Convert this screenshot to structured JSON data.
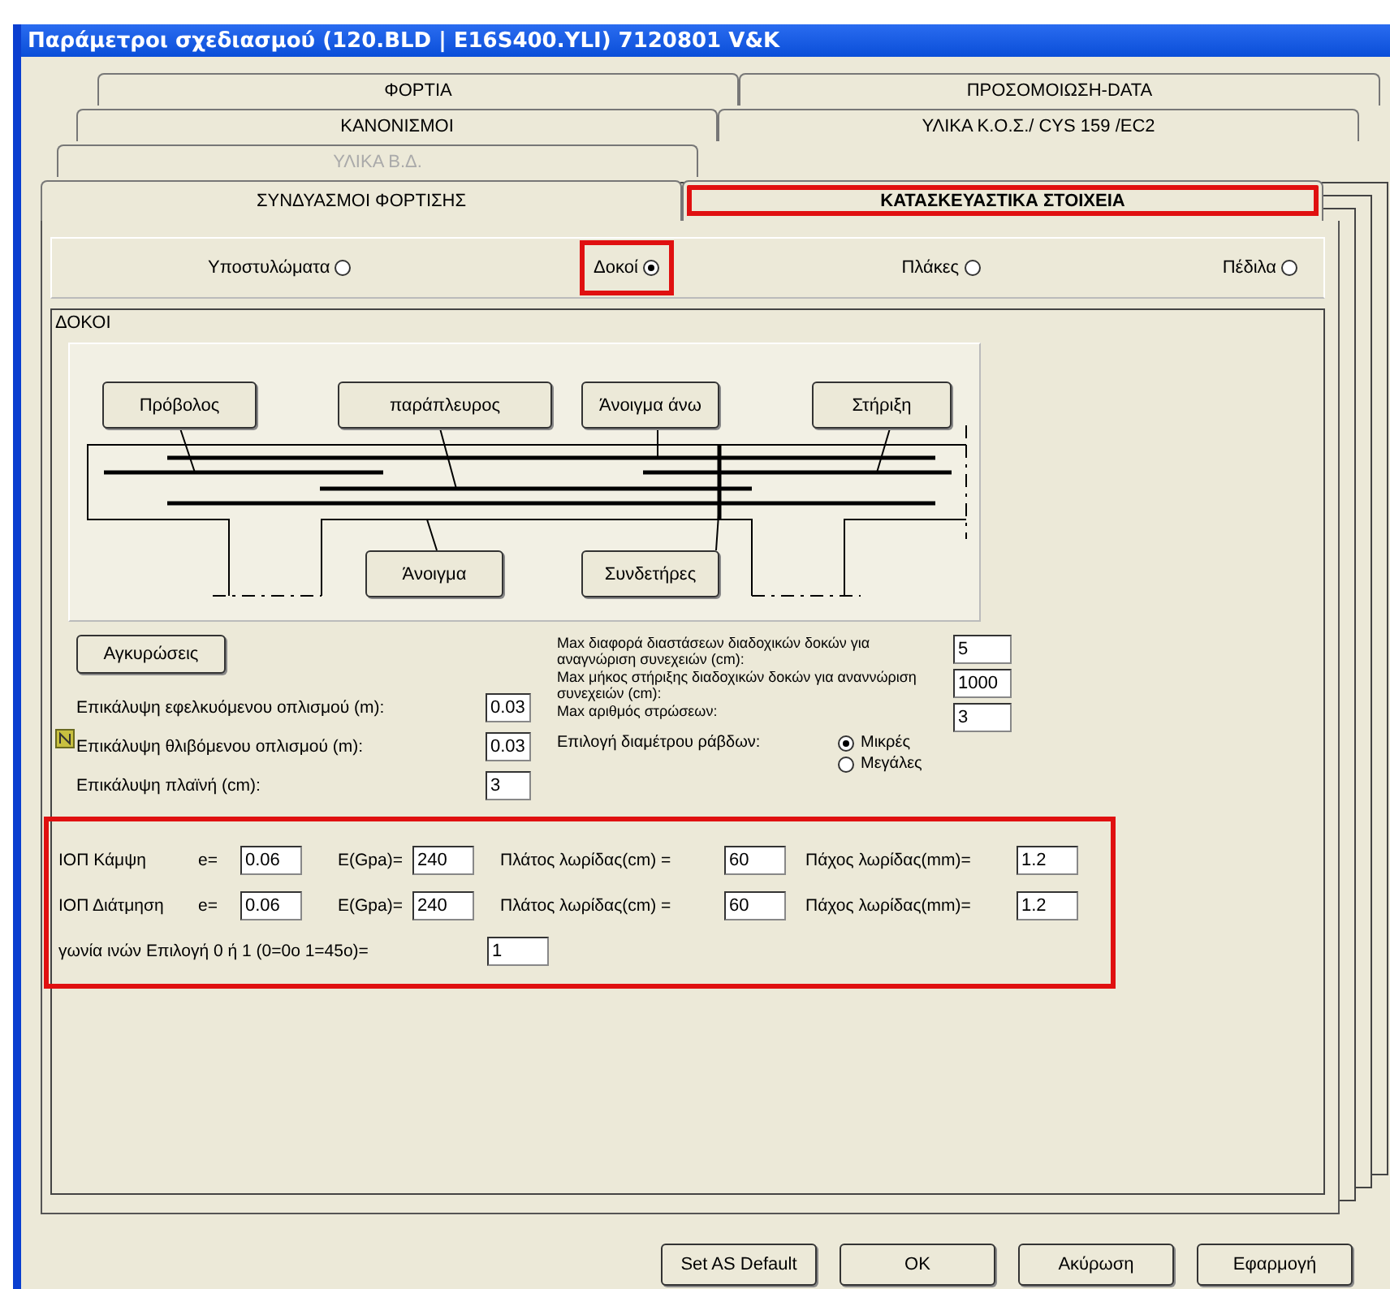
{
  "window": {
    "title": "Παράμετροι σχεδιασμού (120.BLD | E16S400.YLI) 7120801  V&K"
  },
  "tab_rows": [
    [
      {
        "label": "ΦΟΡΤΙΑ",
        "selected": false,
        "disabled": false,
        "highlighted": false
      },
      {
        "label": "ΠΡΟΣΟΜΟΙΩΣΗ-DATA",
        "selected": false,
        "disabled": false,
        "highlighted": false
      }
    ],
    [
      {
        "label": "ΚΑΝΟΝΙΣΜΟΙ",
        "selected": false,
        "disabled": false,
        "highlighted": false
      },
      {
        "label": "ΥΛΙΚΑ Κ.Ο.Σ./ CYS 159 /EC2",
        "selected": false,
        "disabled": false,
        "highlighted": false
      }
    ],
    [
      {
        "label": "ΥΛΙΚΑ Β.Δ.",
        "selected": false,
        "disabled": true,
        "highlighted": false
      }
    ],
    [
      {
        "label": "ΣΥΝΔΥΑΣΜΟΙ ΦΟΡΤΙΣΗΣ",
        "selected": false,
        "disabled": false,
        "highlighted": false
      },
      {
        "label": "ΚΑΤΑΣΚΕΥΑΣΤΙΚΑ ΣΤΟΙΧΕΙΑ",
        "selected": true,
        "disabled": false,
        "highlighted": true
      }
    ]
  ],
  "element_types": [
    {
      "label": "Υποστυλώματα",
      "selected": false,
      "highlighted": false
    },
    {
      "label": "Δοκοί",
      "selected": true,
      "highlighted": true
    },
    {
      "label": "Πλάκες",
      "selected": false,
      "highlighted": false
    },
    {
      "label": "Πέδιλα",
      "selected": false,
      "highlighted": false
    }
  ],
  "group": {
    "title": "ΔΟΚΟΙ"
  },
  "diagram": {
    "callouts": [
      "Πρόβολος",
      "παράπλευρος",
      "Άνοιγμα άνω",
      "Στήριξη",
      "Άνοιγμα",
      "Συνδετήρες"
    ]
  },
  "anchor_button": "Αγκυρώσεις",
  "left_fields": [
    {
      "label": "Επικάλυψη εφελκυόμενου οπλισμού (m):",
      "value": "0.03"
    },
    {
      "label": "Επικάλυψη θλιβόμενου οπλισμού (m):",
      "value": "0.03"
    },
    {
      "label": "Επικάλυψη πλαϊνή (cm):",
      "value": "3"
    }
  ],
  "right_fields": [
    {
      "label": "Max διαφορά διαστάσεων διαδοχικών δοκών για αναγνώριση συνεχειών (cm):",
      "value": "5"
    },
    {
      "label": "Max μήκος  στήριξης  διαδοχικών δοκών για αναννώριση συνεχειών   (cm):",
      "value": "1000"
    },
    {
      "label": "Max αριθμός στρώσεων:",
      "value": "3"
    }
  ],
  "bar_diameter": {
    "label": "Επιλογή διαμέτρου ράβδων:",
    "options": [
      {
        "label": "Μικρές",
        "selected": true
      },
      {
        "label": "Μεγάλες",
        "selected": false
      }
    ]
  },
  "frp": {
    "highlighted": true,
    "rows": [
      {
        "name": "ΙΟΠ Κάμψη",
        "fields": [
          {
            "label": "e=",
            "value": "0.06"
          },
          {
            "label": "E(Gpa)=",
            "value": "240"
          },
          {
            "label": "Πλάτος λωρίδας(cm) =",
            "value": "60"
          },
          {
            "label": "Πάχος λωρίδας(mm)=",
            "value": "1.2"
          }
        ]
      },
      {
        "name": "ΙΟΠ Διάτμηση",
        "fields": [
          {
            "label": "e=",
            "value": "0.06"
          },
          {
            "label": "E(Gpa)=",
            "value": "240"
          },
          {
            "label": "Πλάτος λωρίδας(cm) =",
            "value": "60"
          },
          {
            "label": "Πάχος λωρίδας(mm)=",
            "value": "1.2"
          }
        ]
      }
    ],
    "angle": {
      "label": "γωνία ινών Επιλογή 0 ή 1 (0=0o 1=45o)=",
      "value": "1"
    }
  },
  "buttons": [
    "Set AS Default",
    "OK",
    "Ακύρωση",
    "Εφαρμογή"
  ]
}
